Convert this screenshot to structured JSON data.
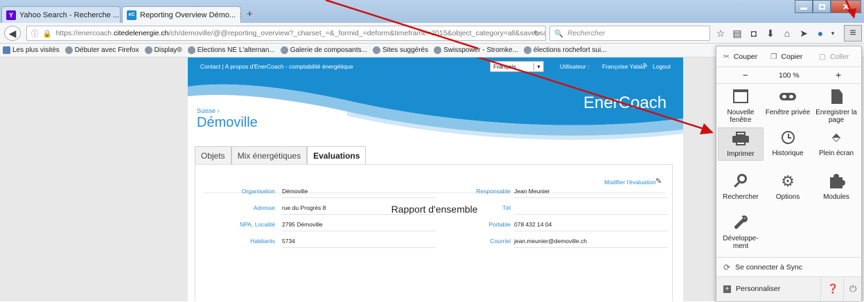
{
  "browser": {
    "tabs": [
      {
        "favicon": "Y",
        "favicon_color": "#6001d2",
        "title": "Yahoo Search - Recherche ..."
      },
      {
        "favicon": "eC",
        "favicon_color": "#1a8dd0",
        "title": "Reporting Overview Démo..."
      }
    ],
    "new_tab": "+",
    "close_tab": "×",
    "url_prefix": "https://enercoach.",
    "url_domain": "citedelenergie.ch",
    "url_rest": "/ch/demoville/@@reporting_overview?_charset_=&_formid_=deform&timeframe=2015&object_category=all&save=save",
    "search_placeholder": "Rechercher",
    "bookmarks": [
      "Les plus visités",
      "Débuter avec Firefox",
      "Display®",
      "Elections NE L'alternan...",
      "Galerie de composants...",
      "Sites suggérés",
      "Swisspower - Stromke...",
      "élections rochefort sui..."
    ]
  },
  "site": {
    "top_links": "Contact  |  A propos d'EnerCoach - comptabilité énergétique",
    "language": "Français",
    "user_label": "Utilisateur :",
    "user_name": "Françoise Yalala",
    "logout": "Logout",
    "brand": "EnerCoach",
    "breadcrumb": "Suisse ›",
    "title": "Démoville",
    "tabs": [
      "Objets",
      "Mix énergétiques",
      "Evaluations"
    ],
    "edit_link": "Modifier l'évaluation",
    "report_title": "Rapport d'ensemble",
    "left_fields": [
      {
        "label": "Organisation",
        "value": "Démoville"
      },
      {
        "label": "Adresse",
        "value": "rue du Progrès 8"
      },
      {
        "label": "NPA, Localité",
        "value": "2795 Démoville"
      },
      {
        "label": "Habitants",
        "value": "5734"
      }
    ],
    "right_fields": [
      {
        "label": "Responsable",
        "value": "Jean Meunier"
      },
      {
        "label": "Tél",
        "value": ""
      },
      {
        "label": "Portable",
        "value": "078 432 14 04"
      },
      {
        "label": "Courriel",
        "value": "jean.meunier@demoville.ch"
      }
    ]
  },
  "menu": {
    "cut": "Couper",
    "copy": "Copier",
    "paste": "Coller",
    "zoom_out": "−",
    "zoom": "100 %",
    "zoom_in": "+",
    "items": [
      [
        "Nouvelle fenêtre",
        "Fenêtre privée",
        "Enregistrer la page"
      ],
      [
        "Imprimer",
        "Historique",
        "Plein écran"
      ],
      [
        "Rechercher",
        "Options",
        "Modules"
      ],
      [
        "Développe-ment"
      ]
    ],
    "sync": "Se connecter à Sync",
    "customize": "Personnaliser"
  },
  "colors": {
    "accent": "#1a8dd0",
    "arrow": "#cc1111"
  }
}
